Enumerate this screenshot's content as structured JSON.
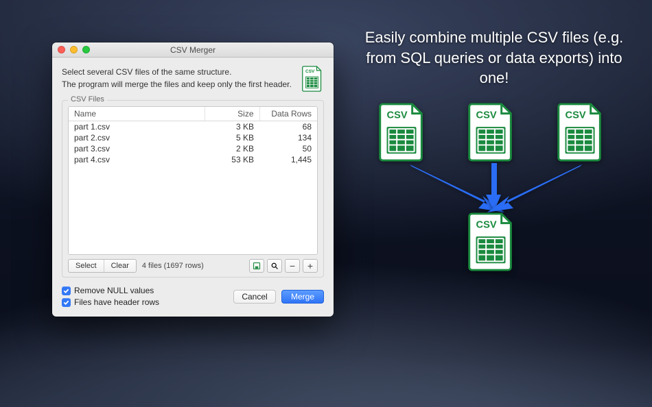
{
  "window": {
    "title": "CSV Merger",
    "intro_line1": "Select several CSV files of the same structure.",
    "intro_line2": "The program will merge the files and keep only the first header."
  },
  "group_label": "CSV Files",
  "columns": {
    "name": "Name",
    "size": "Size",
    "rows": "Data Rows"
  },
  "files": [
    {
      "name": "part 1.csv",
      "size": "3 KB",
      "rows": "68"
    },
    {
      "name": "part 2.csv",
      "size": "5 KB",
      "rows": "134"
    },
    {
      "name": "part 3.csv",
      "size": "2 KB",
      "rows": "50"
    },
    {
      "name": "part 4.csv",
      "size": "53 KB",
      "rows": "1,445"
    }
  ],
  "toolbar": {
    "select": "Select",
    "clear": "Clear",
    "status": "4 files (1697 rows)"
  },
  "checks": {
    "remove_null": "Remove NULL values",
    "headers": "Files have header rows"
  },
  "actions": {
    "cancel": "Cancel",
    "merge": "Merge"
  },
  "promo": {
    "headline": "Easily combine multiple CSV files (e.g. from SQL queries or data exports) into one!"
  },
  "icon_label": "CSV"
}
